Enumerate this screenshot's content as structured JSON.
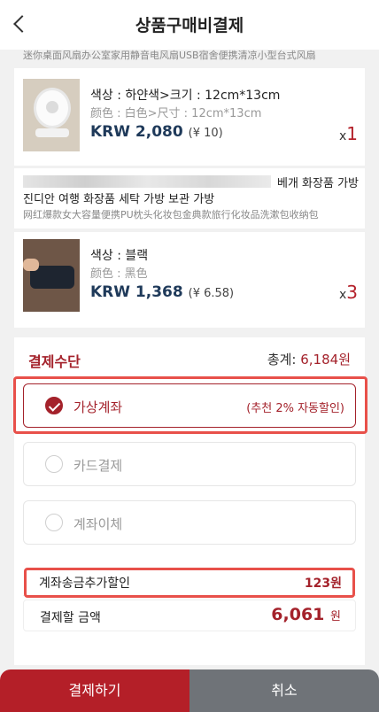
{
  "header": {
    "title": "상품구매비결제"
  },
  "items": [
    {
      "title_cn": "迷你桌面风扇办公室家用静音电风扇USB宿舍便携清凉小型台式风扇",
      "option_kr": "색상 : 하얀색>크기 : 12cm*13cm",
      "option_cn": "颜色 : 白色>尺寸 : 12cm*13cm",
      "price_krw": "KRW 2,080",
      "price_cny": "(¥ 10)",
      "qty_prefix": "x",
      "qty": "1"
    },
    {
      "title_tail": "베개 화장품 가방",
      "title_kr": "진디안 여행 화장품 세탁 가방 보관 가방",
      "title_cn": "网红爆款女大容量便携PU枕头化妆包金典款旅行化妆品洗漱包收纳包",
      "option_kr": "색상 : 블랙",
      "option_cn": "颜色 : 黑色",
      "price_krw": "KRW 1,368",
      "price_cny": "(¥ 6.58)",
      "qty_prefix": "x",
      "qty": "3"
    }
  ],
  "payment": {
    "title": "결제수단",
    "total_label": "총계:",
    "total_value": "6,184원",
    "methods": [
      {
        "label": "가상계좌",
        "note": "(추천 2% 자동할인)",
        "selected": true
      },
      {
        "label": "카드결제",
        "selected": false
      },
      {
        "label": "계좌이체",
        "selected": false
      }
    ],
    "discount_label": "계좌송금추가할인",
    "discount_value": "123원",
    "final_label": "결제할 금액",
    "final_value": "6,061",
    "final_unit": "원"
  },
  "buttons": {
    "pay": "결제하기",
    "cancel": "취소"
  },
  "colors": {
    "accent": "#a4222b",
    "price_blue": "#1f3a5a",
    "highlight": "#e8504a",
    "cancel_gray": "#6f7378"
  }
}
